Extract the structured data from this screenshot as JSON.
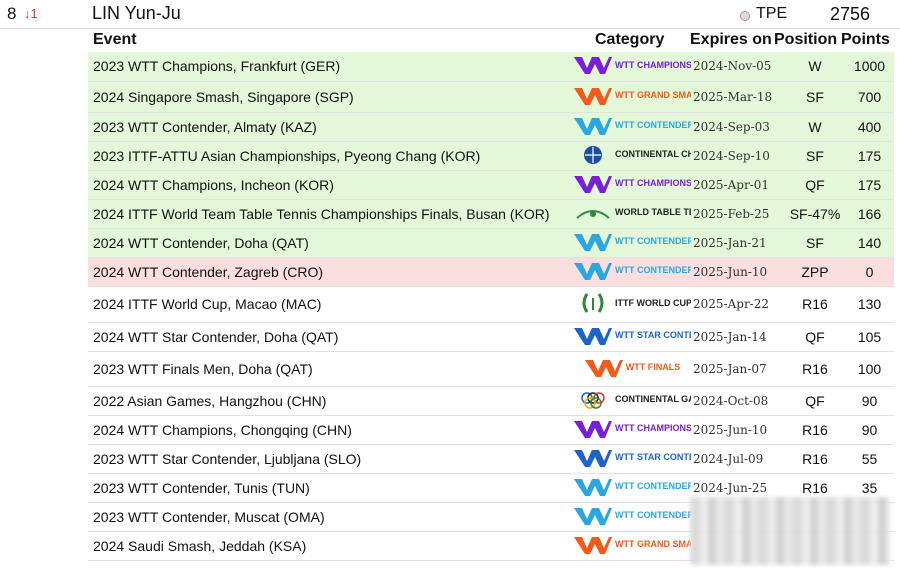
{
  "player": {
    "rank": "8",
    "rank_change": "↓1",
    "name": "LIN Yun-Ju",
    "country": "TPE",
    "total_points": "2756"
  },
  "columns": {
    "event": "Event",
    "category": "Category",
    "expires": "Expires on",
    "position": "Position",
    "points": "Points"
  },
  "colors": {
    "counted_row": "#e3f8d8",
    "dropped_row": "#fbdede",
    "wtt_purple": "#7a1fd6",
    "wtt_blue": "#2aa7e0",
    "wtt_orange": "#f05a1a",
    "wtt_darkblue": "#1e64c8"
  },
  "rows": [
    {
      "event": "2023 WTT Champions, Frankfurt (GER)",
      "category": "WTT CHAMPIONS",
      "logo": "champions",
      "expires": "2024-Nov-05",
      "position": "W",
      "points": "1000",
      "status": "g"
    },
    {
      "event": "2024 Singapore Smash, Singapore (SGP)",
      "category": "WTT GRAND SMASH",
      "logo": "smash",
      "expires": "2025-Mar-18",
      "position": "SF",
      "points": "700",
      "status": "g"
    },
    {
      "event": "2023 WTT Contender, Almaty (KAZ)",
      "category": "WTT CONTENDER",
      "logo": "contender",
      "expires": "2024-Sep-03",
      "position": "W",
      "points": "400",
      "status": "g"
    },
    {
      "event": "2023 ITTF-ATTU Asian Championships, Pyeong Chang (KOR)",
      "category": "CONTINENTAL CHAMPIONSHIPS",
      "logo": "continental",
      "expires": "2024-Sep-10",
      "position": "SF",
      "points": "175",
      "status": "g"
    },
    {
      "event": "2024 WTT Champions, Incheon (KOR)",
      "category": "WTT CHAMPIONS",
      "logo": "champions",
      "expires": "2025-Apr-01",
      "position": "QF",
      "points": "175",
      "status": "g"
    },
    {
      "event": "2024 ITTF World Team Table Tennis Championships Finals, Busan (KOR)",
      "category": "WORLD TABLE TENNIS CHAMPIONSHIPS",
      "logo": "worldteam",
      "expires": "2025-Feb-25",
      "position": "SF-47%",
      "points": "166",
      "status": "g"
    },
    {
      "event": "2024 WTT Contender, Doha (QAT)",
      "category": "WTT CONTENDER",
      "logo": "contender",
      "expires": "2025-Jan-21",
      "position": "SF",
      "points": "140",
      "status": "g"
    },
    {
      "event": "2024 WTT Contender, Zagreb (CRO)",
      "category": "WTT CONTENDER",
      "logo": "contender",
      "expires": "2025-Jun-10",
      "position": "ZPP",
      "points": "0",
      "status": "r"
    },
    {
      "event": "2024 ITTF World Cup, Macao (MAC)",
      "category": "ITTF WORLD CUP",
      "logo": "worldcup",
      "expires": "2025-Apr-22",
      "position": "R16",
      "points": "130",
      "status": ""
    },
    {
      "event": "2024 WTT Star Contender, Doha (QAT)",
      "category": "WTT STAR CONTENDER",
      "logo": "star",
      "expires": "2025-Jan-14",
      "position": "QF",
      "points": "105",
      "status": ""
    },
    {
      "event": "2023 WTT Finals Men, Doha (QAT)",
      "category": "WTT FINALS",
      "logo": "finals",
      "expires": "2025-Jan-07",
      "position": "R16",
      "points": "100",
      "status": ""
    },
    {
      "event": "2022 Asian Games, Hangzhou (CHN)",
      "category": "CONTINENTAL GAMES",
      "logo": "games",
      "expires": "2024-Oct-08",
      "position": "QF",
      "points": "90",
      "status": ""
    },
    {
      "event": "2024 WTT Champions, Chongqing (CHN)",
      "category": "WTT CHAMPIONS",
      "logo": "champions",
      "expires": "2025-Jun-10",
      "position": "R16",
      "points": "90",
      "status": ""
    },
    {
      "event": "2023 WTT Star Contender, Ljubljana (SLO)",
      "category": "WTT STAR CONTENDER",
      "logo": "star",
      "expires": "2024-Jul-09",
      "position": "R16",
      "points": "55",
      "status": ""
    },
    {
      "event": "2023 WTT Contender, Tunis (TUN)",
      "category": "WTT CONTENDER",
      "logo": "contender",
      "expires": "2024-Jun-25",
      "position": "R16",
      "points": "35",
      "status": ""
    },
    {
      "event": "2023 WTT Contender, Muscat (OMA)",
      "category": "WTT CONTENDER",
      "logo": "contender",
      "expires": "",
      "position": "",
      "points": "",
      "status": ""
    },
    {
      "event": "2024 Saudi Smash, Jeddah (KSA)",
      "category": "WTT GRAND SMASH",
      "logo": "smash",
      "expires": "",
      "position": "",
      "points": "",
      "status": ""
    }
  ]
}
